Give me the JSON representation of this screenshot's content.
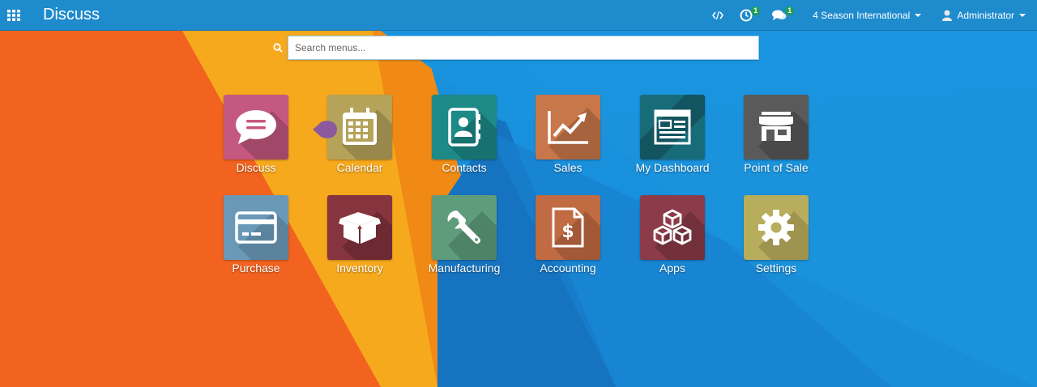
{
  "navbar": {
    "title": "Discuss",
    "apps_icon": "grid-icon",
    "debug_icon": "code-icon",
    "activity_count": "1",
    "messages_count": "1",
    "company": "4 Season International",
    "user": "Administrator"
  },
  "search": {
    "placeholder": "Search menus..."
  },
  "apps": [
    {
      "label": "Discuss",
      "icon": "chat-bubble-icon",
      "color": "#c5587f"
    },
    {
      "label": "Calendar",
      "icon": "calendar-icon",
      "color": "#b5a35a"
    },
    {
      "label": "Contacts",
      "icon": "address-book-icon",
      "color": "#1d8a88"
    },
    {
      "label": "Sales",
      "icon": "line-chart-icon",
      "color": "#c8774a"
    },
    {
      "label": "My Dashboard",
      "icon": "dashboard-window-icon",
      "color": "#186c7a"
    },
    {
      "label": "Point of Sale",
      "icon": "storefront-icon",
      "color": "#5a5a5a"
    },
    {
      "label": "Purchase",
      "icon": "credit-card-icon",
      "color": "#6a99b8"
    },
    {
      "label": "Inventory",
      "icon": "box-icon",
      "color": "#86343e"
    },
    {
      "label": "Manufacturing",
      "icon": "wrench-icon",
      "color": "#5f9c7c"
    },
    {
      "label": "Accounting",
      "icon": "invoice-dollar-icon",
      "color": "#c16b43"
    },
    {
      "label": "Apps",
      "icon": "cubes-icon",
      "color": "#8c3b48"
    },
    {
      "label": "Settings",
      "icon": "gear-icon",
      "color": "#b8ad5c"
    }
  ]
}
